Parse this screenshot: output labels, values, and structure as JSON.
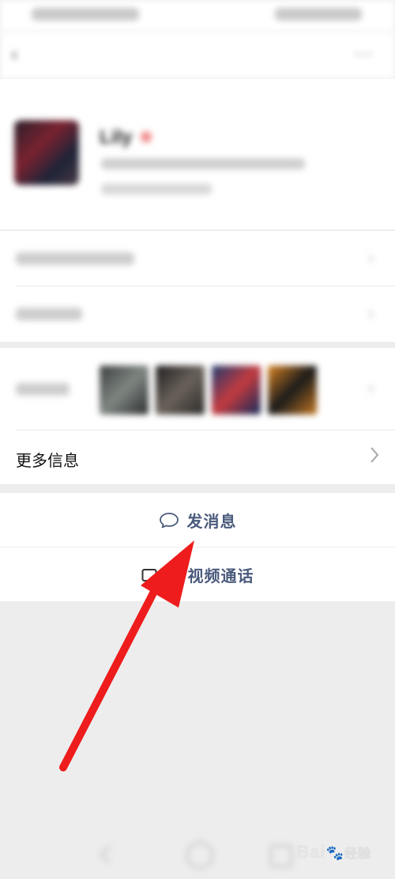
{
  "profile": {
    "nickname": "Lily"
  },
  "more_info": {
    "label": "更多信息"
  },
  "actions": {
    "message_label": "发消息",
    "video_call_label": "音视频通话"
  },
  "icons": {
    "back": "back-arrow-icon",
    "more": "more-dots-icon",
    "chevron": "chevron-right-icon",
    "chat": "chat-bubble-icon",
    "video": "video-camera-icon"
  },
  "colors": {
    "accent_text": "#4a5a7c",
    "annotation_arrow": "#ee1c1c",
    "background": "#ededed"
  },
  "watermark": {
    "brand": "Bai",
    "suffix": "经验"
  }
}
